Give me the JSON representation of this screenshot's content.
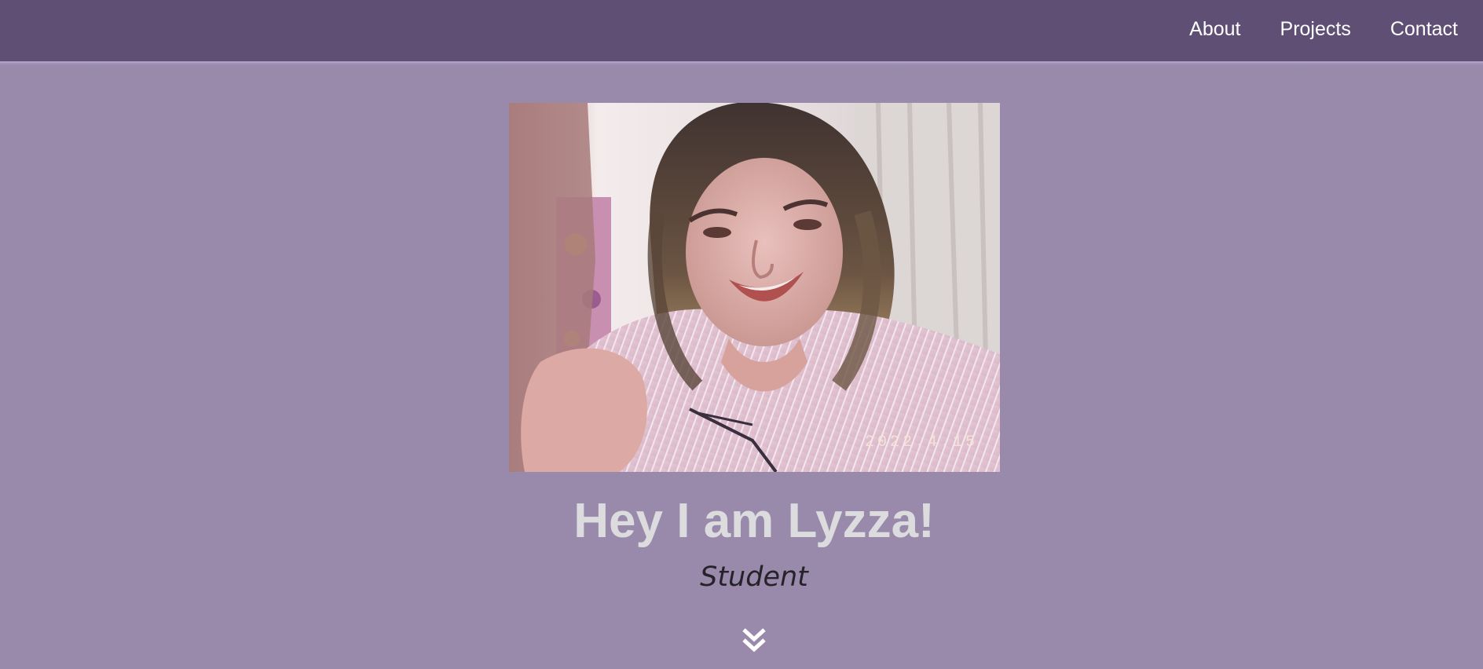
{
  "nav": {
    "items": [
      {
        "label": "About"
      },
      {
        "label": "Projects"
      },
      {
        "label": "Contact"
      }
    ]
  },
  "hero": {
    "photo_date_stamp": "2022.4.15",
    "title": "Hey I am Lyzza!",
    "subtitle": "Student",
    "scroll_icon": "double-chevron-down-icon"
  },
  "colors": {
    "navbar": "#5f4f74",
    "page_background": "#998aab",
    "title_text": "#dcdcdf",
    "subtitle_text": "#262229"
  }
}
